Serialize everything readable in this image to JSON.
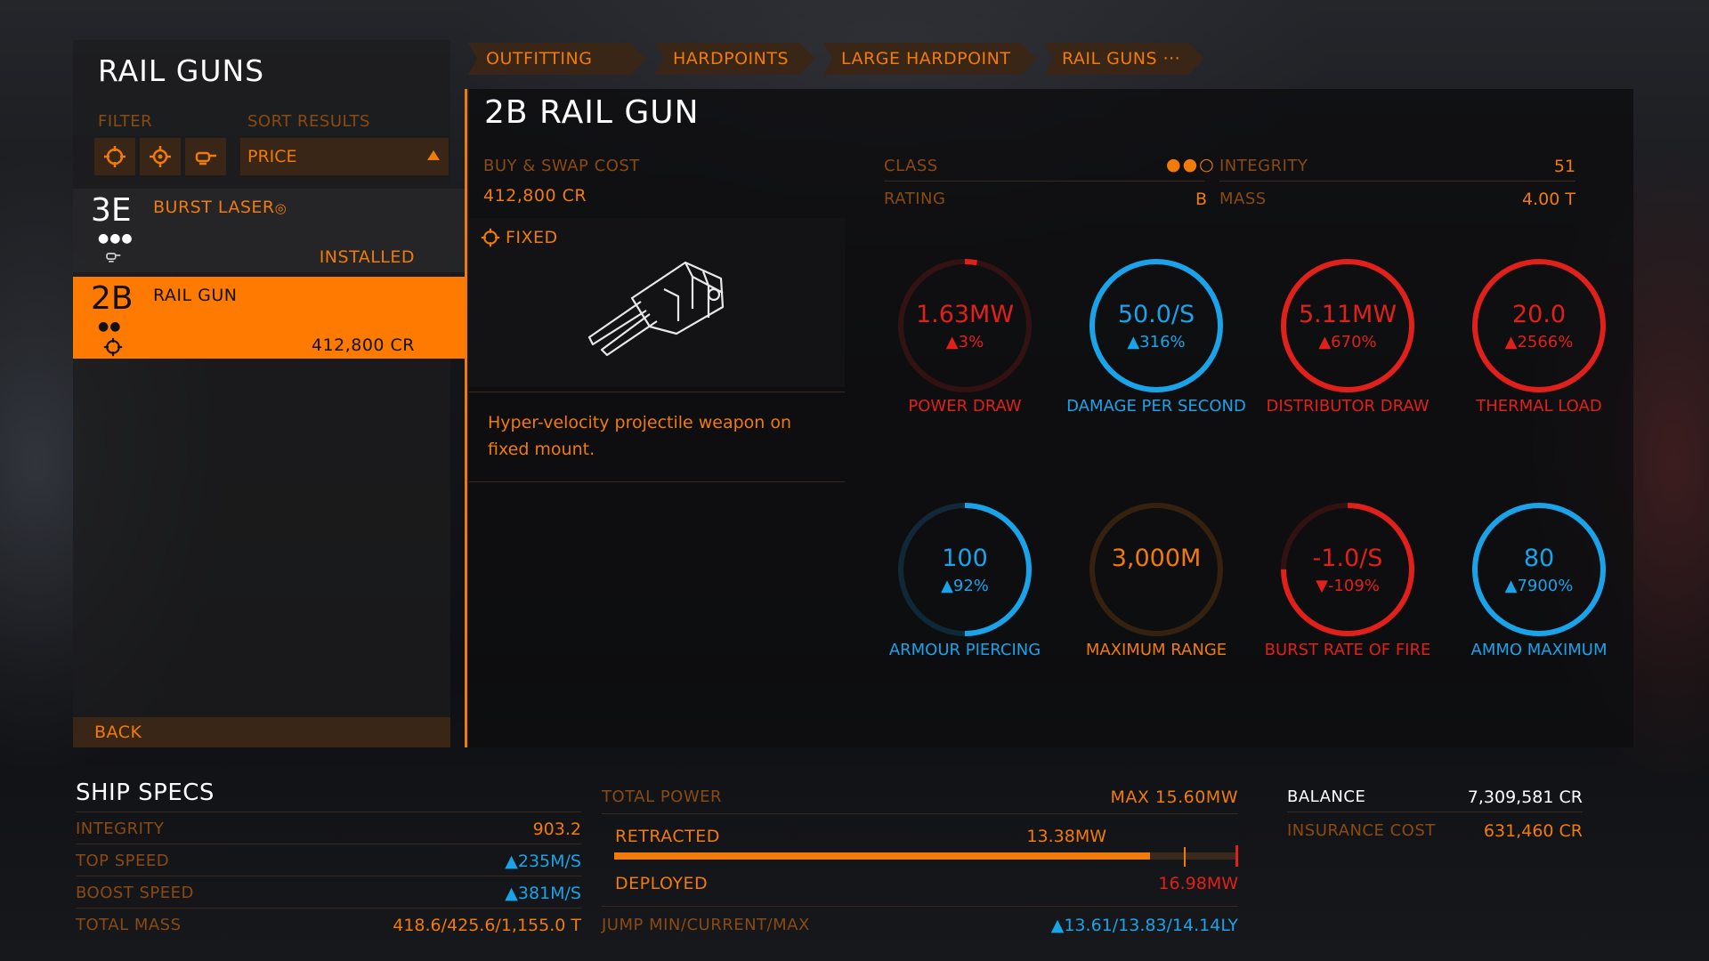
{
  "left": {
    "title": "RAIL GUNS",
    "filter_label": "FILTER",
    "sort_label": "SORT RESULTS",
    "sort_value": "PRICE",
    "filter_icons": [
      "fixed-mount-icon",
      "gimballed-mount-icon",
      "turret-mount-icon"
    ],
    "items": [
      {
        "rank": "3E",
        "name": "BURST LASER",
        "dots": "●●●",
        "status": "INSTALLED"
      },
      {
        "rank": "2B",
        "name": "RAIL GUN",
        "dots": "●●",
        "status": "412,800 CR"
      }
    ],
    "back_label": "BACK"
  },
  "breadcrumb": [
    "OUTFITTING",
    "HARDPOINTS",
    "LARGE HARDPOINT",
    "RAIL GUNS ···"
  ],
  "detail": {
    "title": "2B RAIL GUN",
    "buy_label": "BUY & SWAP COST",
    "buy_value": "412,800 CR",
    "mount_label": "FIXED",
    "class_label": "CLASS",
    "class_value": "●●○",
    "rating_label": "RATING",
    "rating_value": "B",
    "integrity_label": "INTEGRITY",
    "integrity_value": "51",
    "mass_label": "MASS",
    "mass_value": "4.00 T",
    "description": "Hyper-velocity projectile weapon on fixed mount."
  },
  "gauges": [
    {
      "value": "1.63MW",
      "delta": "▲3%",
      "label": "POWER DRAW",
      "color": "#e0201a",
      "fill": 0.03
    },
    {
      "value": "50.0/S",
      "delta": "▲316%",
      "label": "DAMAGE PER SECOND",
      "color": "#1aa3e8",
      "fill": 1.0
    },
    {
      "value": "5.11MW",
      "delta": "▲670%",
      "label": "DISTRIBUTOR DRAW",
      "color": "#e0201a",
      "fill": 1.0
    },
    {
      "value": "20.0",
      "delta": "▲2566%",
      "label": "THERMAL LOAD",
      "color": "#e0201a",
      "fill": 1.0
    },
    {
      "value": "100",
      "delta": "▲92%",
      "label": "ARMOUR PIERCING",
      "color": "#1aa3e8",
      "fill": 0.5
    },
    {
      "value": "3,000M",
      "delta": "",
      "label": "MAXIMUM RANGE",
      "color": "#f07b0a",
      "fill": 0.0
    },
    {
      "value": "-1.0/S",
      "delta": "▼-109%",
      "label": "BURST RATE OF FIRE",
      "color": "#e0201a",
      "fill": 0.75
    },
    {
      "value": "80",
      "delta": "▲7900%",
      "label": "AMMO MAXIMUM",
      "color": "#1aa3e8",
      "fill": 1.0
    }
  ],
  "ship_specs": {
    "title": "SHIP SPECS",
    "rows": [
      {
        "label": "INTEGRITY",
        "value": "903.2"
      },
      {
        "label": "TOP SPEED",
        "value": "▲235M/S"
      },
      {
        "label": "BOOST SPEED",
        "value": "▲381M/S"
      },
      {
        "label": "TOTAL MASS",
        "value": "418.6/425.6/1,155.0 T"
      }
    ]
  },
  "power": {
    "total_label": "TOTAL POWER",
    "max_value": "MAX 15.60MW",
    "retracted_label": "RETRACTED",
    "retracted_value": "13.38MW",
    "deployed_label": "DEPLOYED",
    "deployed_value": "16.98MW",
    "retracted_fraction": 0.86,
    "jump_label": "JUMP MIN/CURRENT/MAX",
    "jump_value": "▲13.61/13.83/14.14LY"
  },
  "finance": {
    "balance_label": "BALANCE",
    "balance_value": "7,309,581 CR",
    "insurance_label": "INSURANCE COST",
    "insurance_value": "631,460 CR"
  }
}
